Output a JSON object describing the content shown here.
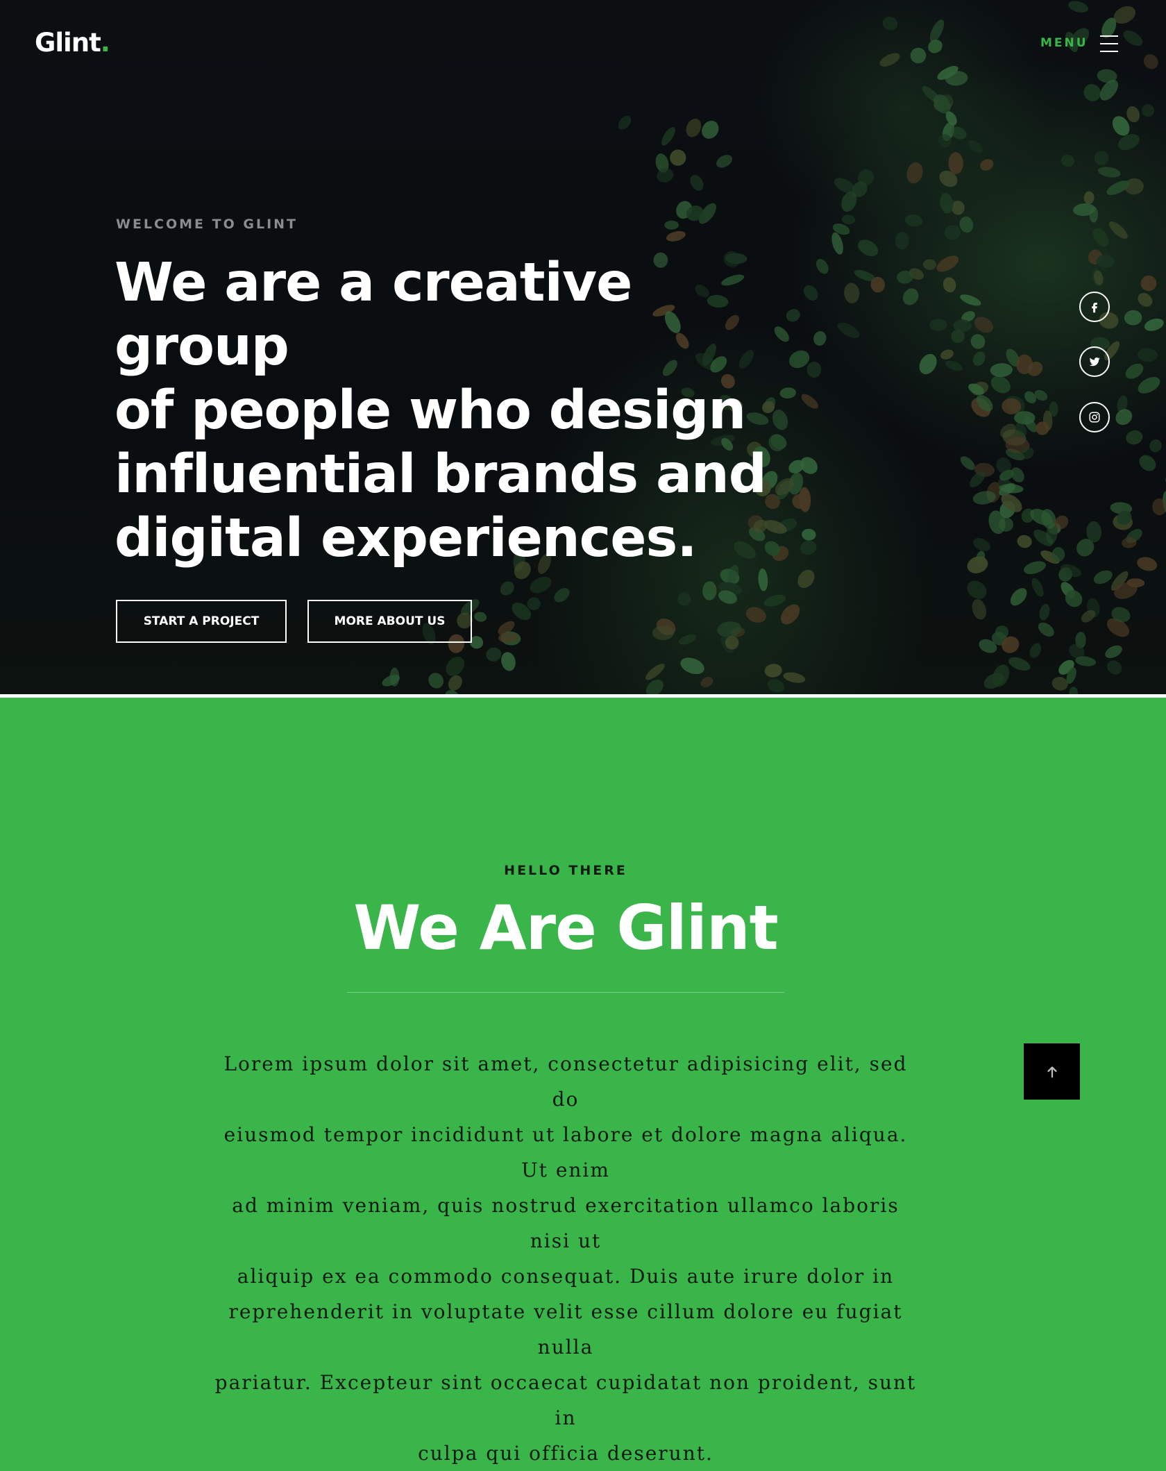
{
  "header": {
    "logo_text": "Glint",
    "logo_dot": ".",
    "menu_label": "MENU"
  },
  "hero": {
    "eyebrow": "WELCOME TO GLINT",
    "headline_lines": [
      "We are a creative group",
      "of people who design",
      "influential brands and",
      "digital experiences."
    ],
    "buttons": {
      "start_project": "START A PROJECT",
      "more_about": "MORE ABOUT US"
    },
    "social_icons": [
      "facebook-icon",
      "twitter-icon",
      "instagram-icon"
    ]
  },
  "about": {
    "eyebrow": "HELLO THERE",
    "title": "We Are Glint",
    "body_lines": [
      "Lorem ipsum dolor sit amet, consectetur adipisicing elit, sed do",
      "eiusmod tempor incididunt ut labore et dolore magna aliqua. Ut enim",
      "ad minim veniam, quis nostrud exercitation ullamco laboris nisi ut",
      "aliquip ex ea commodo consequat. Duis aute irure dolor in",
      "reprehenderit in voluptate velit esse cillum dolore eu fugiat nulla",
      "pariatur. Excepteur sint occaecat cupidatat non proident, sunt in",
      "culpa qui officia deserunt."
    ],
    "back_to_top_icon": "arrow-up-icon"
  },
  "colors": {
    "accent": "#39b54a",
    "hero_bg": "#0b0f12",
    "white": "#ffffff",
    "back_to_top_bg": "#000000"
  }
}
